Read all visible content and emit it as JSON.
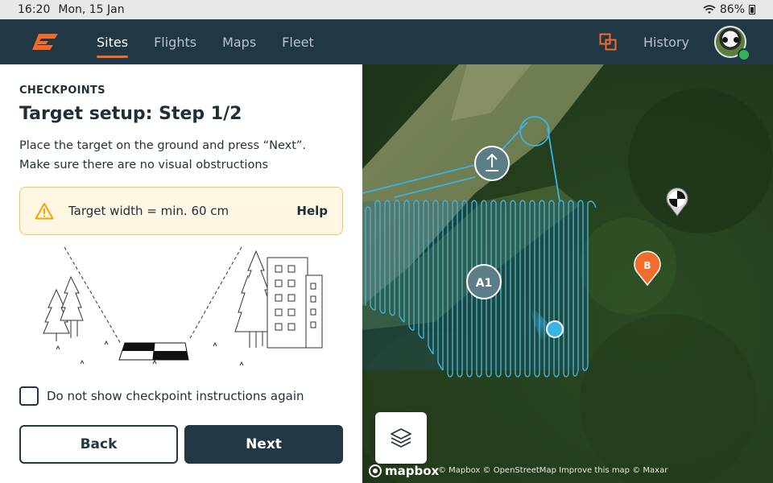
{
  "status_bar": {
    "time": "16:20",
    "date": "Mon, 15 Jan",
    "battery": "86%"
  },
  "nav": {
    "tabs": [
      {
        "label": "Sites",
        "active": true
      },
      {
        "label": "Flights",
        "active": false
      },
      {
        "label": "Maps",
        "active": false
      },
      {
        "label": "Fleet",
        "active": false
      }
    ],
    "history_label": "History",
    "accent_color": "#f26b2a",
    "bar_color": "#213743"
  },
  "panel": {
    "eyebrow": "CHECKPOINTS",
    "title": "Target setup: Step 1/2",
    "description_line1": "Place the target on the ground and press “Next”.",
    "description_line2": "Make sure there are no visual obstructions",
    "alert": {
      "icon": "warning-icon",
      "text": "Target width = min. 60 cm",
      "help_label": "Help"
    },
    "checkbox_label": "Do not show checkpoint instructions again",
    "checkbox_checked": false,
    "back_label": "Back",
    "next_label": "Next"
  },
  "map": {
    "markers": {
      "area_label": "A1",
      "point_b_label": "B",
      "upload_icon": "upload-icon",
      "checkpoint_icon": "checkpoint-target-icon"
    },
    "layers_icon": "layers-icon",
    "mapbox_label": "mapbox",
    "attribution": "© Mapbox © OpenStreetMap Improve this map © Maxar",
    "route_color": "#3ab4e6",
    "marker_b_color": "#f26b2a"
  }
}
